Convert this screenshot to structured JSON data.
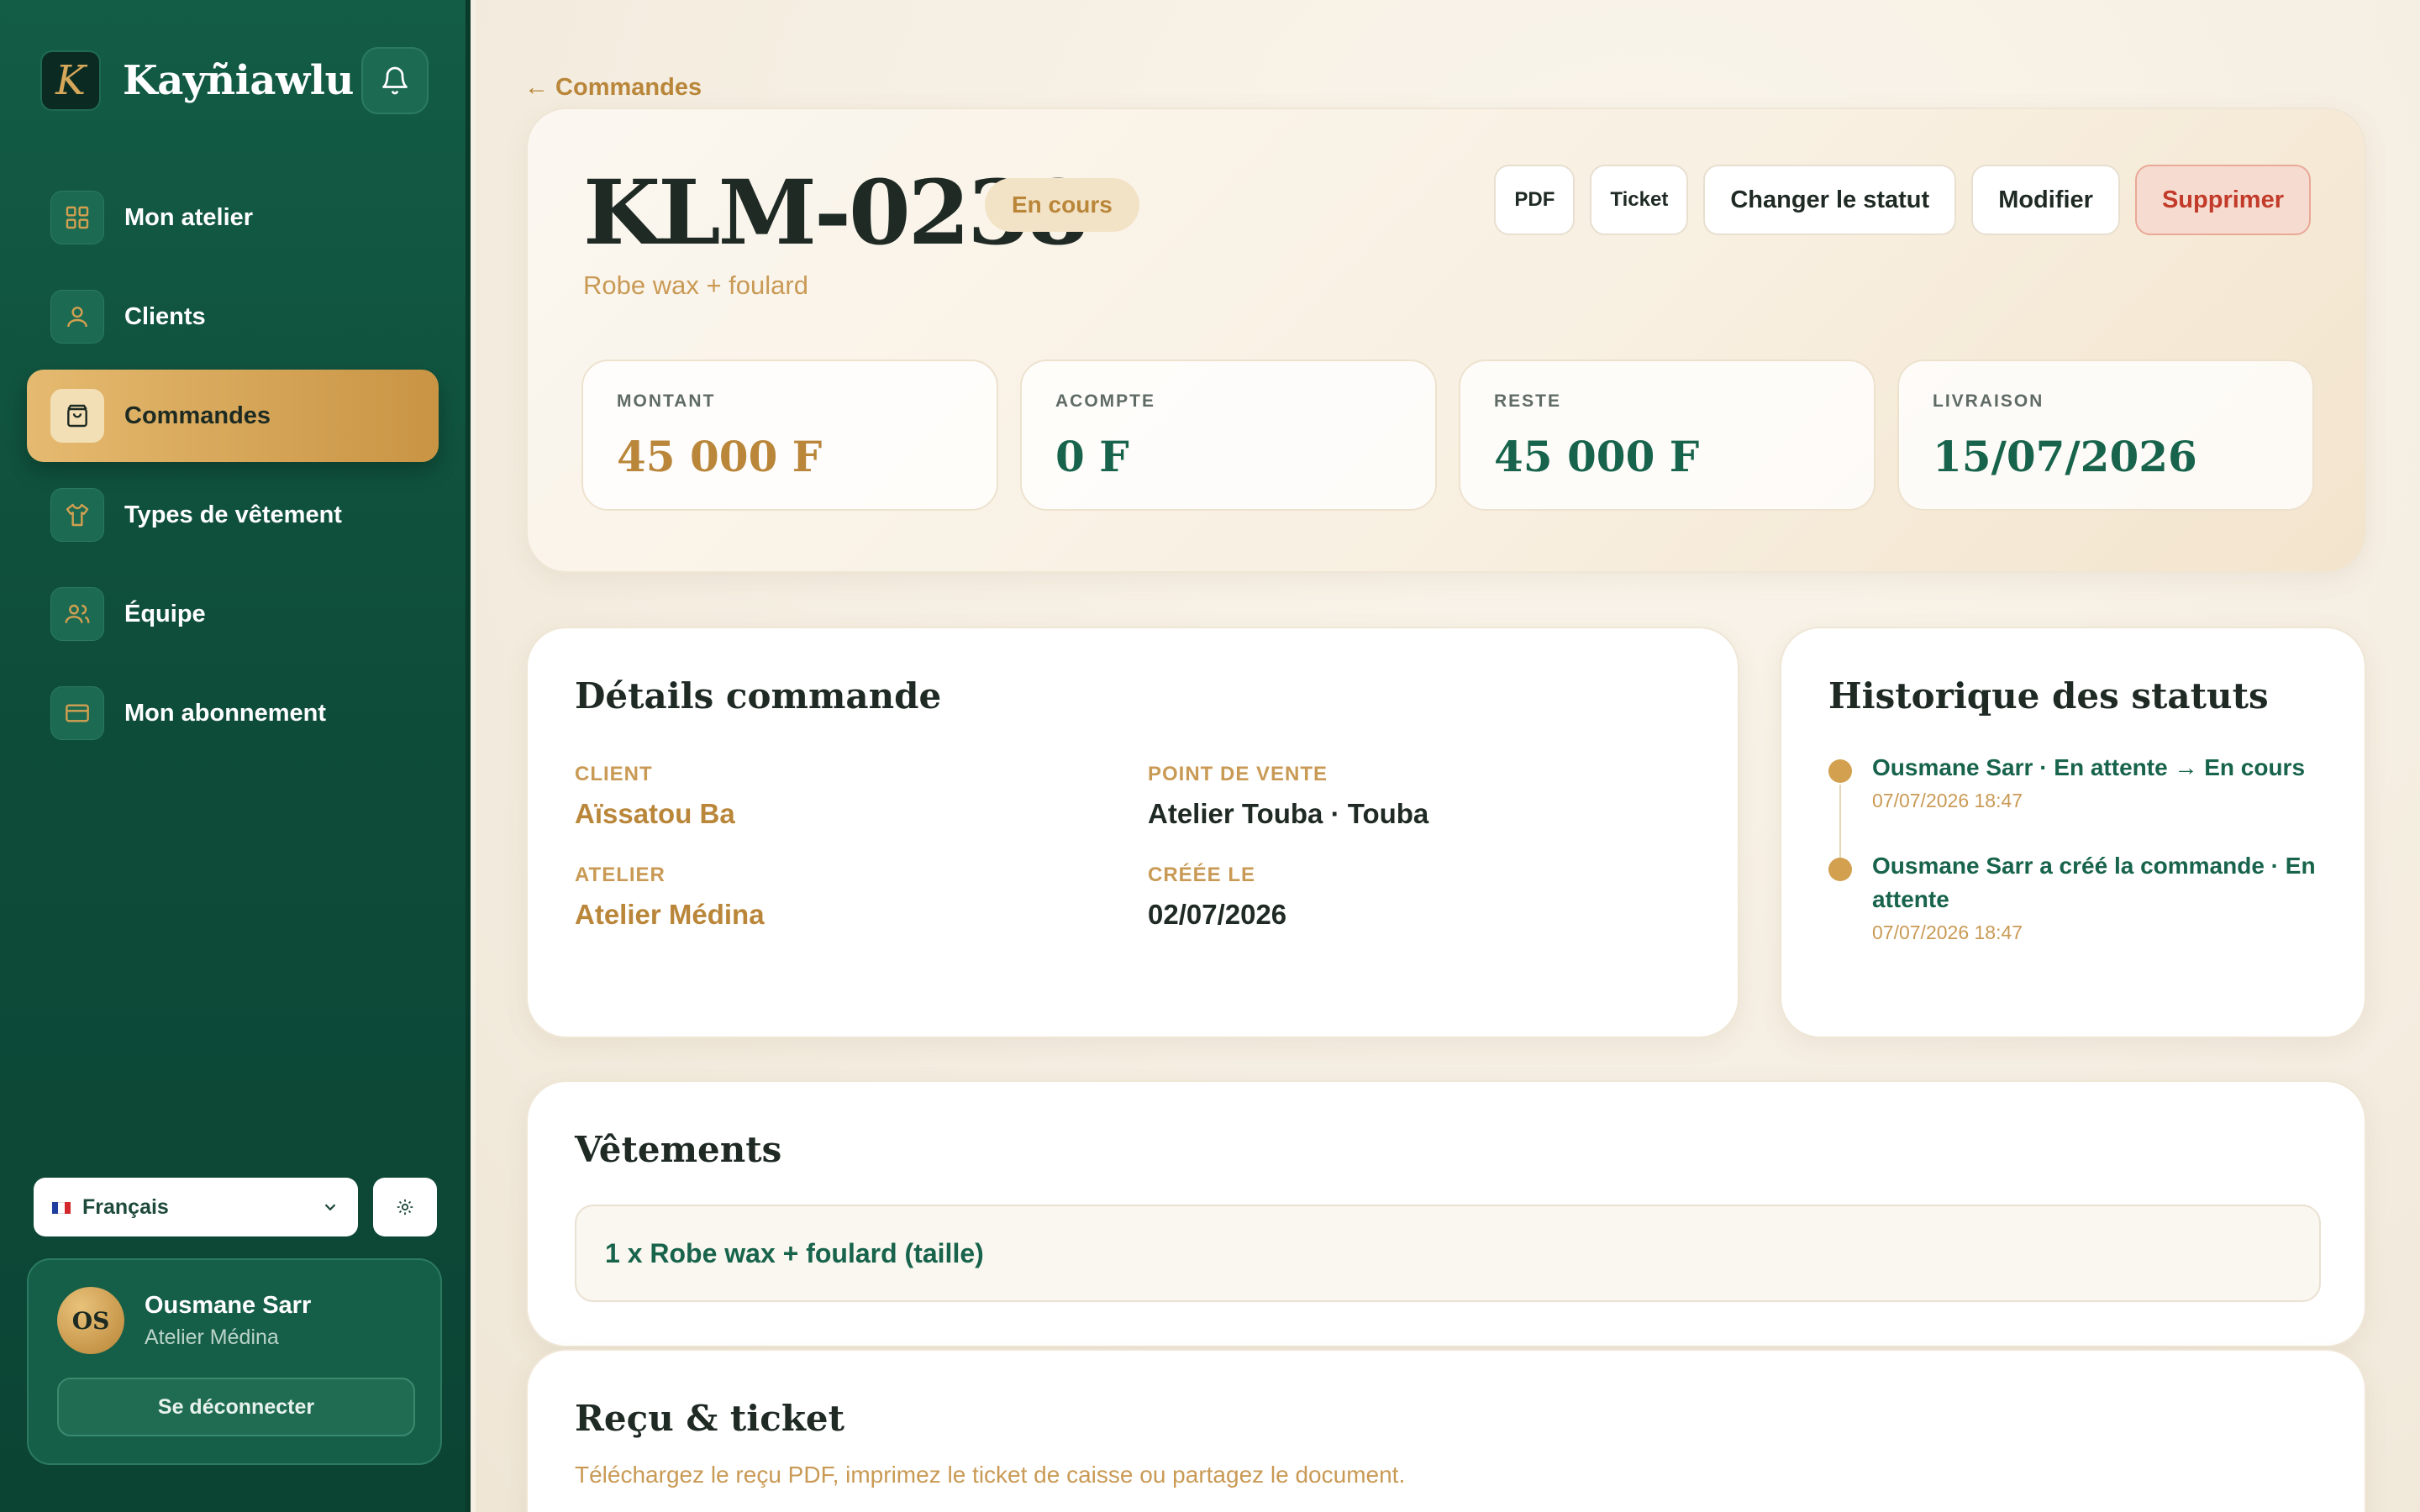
{
  "sidebar": {
    "brand_name": "Kayñiawlu",
    "brand_logo_letter": "K",
    "nav_items": [
      {
        "label": "Mon atelier",
        "icon": "dashboard-icon"
      },
      {
        "label": "Clients",
        "icon": "user-icon"
      },
      {
        "label": "Commandes",
        "icon": "shopping-bag-icon",
        "active": true
      },
      {
        "label": "Types de vêtement",
        "icon": "shirt-icon"
      },
      {
        "label": "Équipe",
        "icon": "team-icon"
      },
      {
        "label": "Mon abonnement",
        "icon": "credit-card-icon"
      }
    ],
    "language": "Français",
    "user": {
      "initials": "OS",
      "name": "Ousmane Sarr",
      "workshop": "Atelier Médina"
    },
    "logout_label": "Se déconnecter"
  },
  "main": {
    "back_label": "← Commandes",
    "order": {
      "id": "KLM-0238",
      "status": "En cours",
      "subtitle": "Robe wax + foulard"
    },
    "actions": {
      "pdf": "PDF",
      "ticket": "Ticket",
      "change_status": "Changer le statut",
      "edit": "Modifier",
      "delete": "Supprimer"
    },
    "stats": [
      {
        "label": "MONTANT",
        "value": "45 000 F",
        "color": "#b9863a"
      },
      {
        "label": "ACOMPTE",
        "value": "0 F",
        "color": "#17634b"
      },
      {
        "label": "RESTE",
        "value": "45 000 F",
        "color": "#17634b"
      },
      {
        "label": "LIVRAISON",
        "value": "15/07/2026",
        "color": "#17634b"
      }
    ],
    "details": {
      "title": "Détails commande",
      "client_label": "CLIENT",
      "client_value": "Aïssatou Ba",
      "pos_label": "POINT DE VENTE",
      "pos_value": "Atelier Touba · Touba",
      "atelier_label": "ATELIER",
      "atelier_value": "Atelier Médina",
      "created_label": "CRÉÉE LE",
      "created_value": "02/07/2026"
    },
    "history": {
      "title": "Historique des statuts",
      "items": [
        {
          "text": "Ousmane Sarr · En attente → En cours",
          "time": "07/07/2026 18:47"
        },
        {
          "text": "Ousmane Sarr a créé la commande · En attente",
          "time": "07/07/2026 18:47"
        }
      ]
    },
    "garments": {
      "title": "Vêtements",
      "items": [
        "1 x Robe wax + foulard (taille)"
      ]
    },
    "receipt": {
      "title": "Reçu & ticket",
      "description": "Téléchargez le reçu PDF, imprimez le ticket de caisse ou partagez le document."
    }
  },
  "colors": {
    "primary_green": "#135c45",
    "gold": "#c99444",
    "danger": "#c23b2a"
  }
}
